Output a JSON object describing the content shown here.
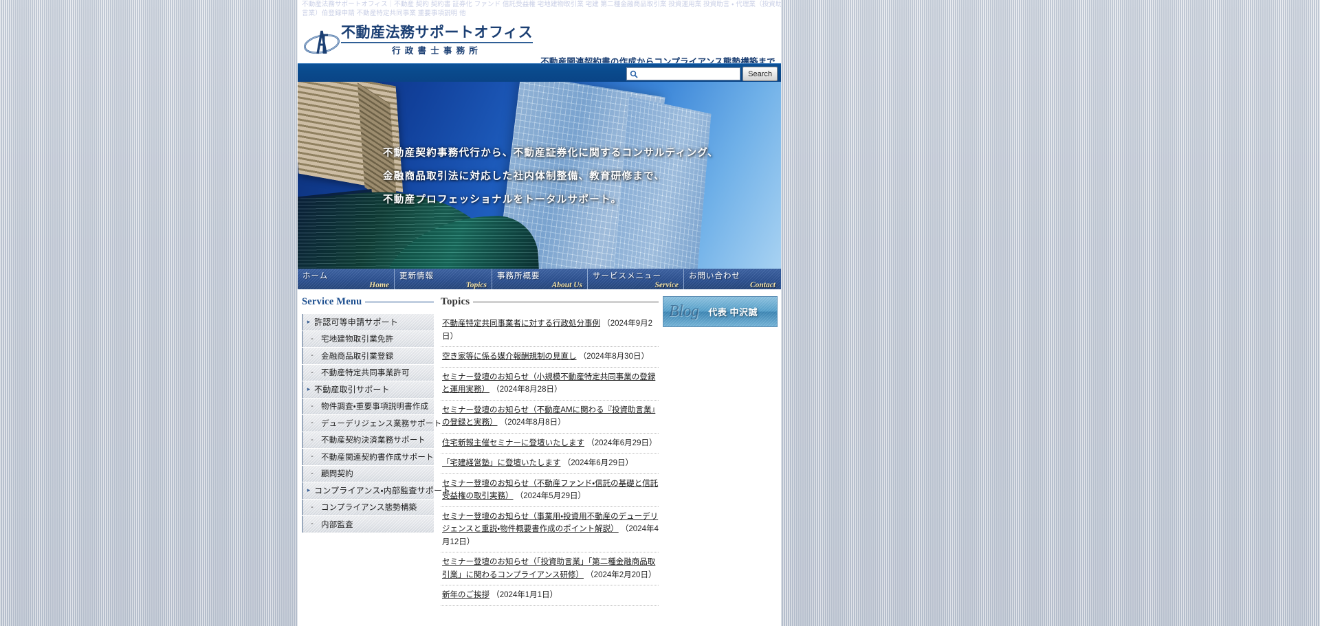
{
  "keyword_strip": "不動産法務サポートオフィス｜不動産 契約 契約書 証券化 ファンド 信託受益権 宅地建物取引業 宅建 第二種金融商品取引業 投資運用業 投資助言 ・ 代理業（投資助言業）伯登録申請 不動産特定共同事業 重要事項説明 他",
  "header": {
    "logo_main": "不動産法務サポートオフィス",
    "logo_sub": "行政書士事務所",
    "logo_icon": "company-monogram-icon",
    "tagline": "不動産関連契約書の作成からコンプライアンス態勢構築まで"
  },
  "search": {
    "icon": "search-icon",
    "value": "",
    "placeholder": "",
    "button_label": "Search"
  },
  "hero": {
    "lines": [
      "不動産契約事務代行から、不動産証券化に関するコンサルティング、",
      "金融商品取引法に対応した社内体制整備、教育研修まで、",
      "不動産プロフェッショナルをトータルサポート。"
    ]
  },
  "nav": [
    {
      "ja": "ホーム",
      "en": "Home"
    },
    {
      "ja": "更新情報",
      "en": "Topics"
    },
    {
      "ja": "事務所概要",
      "en": "About Us"
    },
    {
      "ja": "サービスメニュー",
      "en": "Service"
    },
    {
      "ja": "お問い合わせ",
      "en": "Contact"
    }
  ],
  "sidebar": {
    "heading": "Service Menu",
    "items": [
      {
        "label": "許認可等申請サポート",
        "level": "parent",
        "marker": "▸"
      },
      {
        "label": "宅地建物取引業免許",
        "level": "child",
        "marker": "-"
      },
      {
        "label": "金融商品取引業登録",
        "level": "child",
        "marker": "-"
      },
      {
        "label": "不動産特定共同事業許可",
        "level": "child",
        "marker": "-"
      },
      {
        "label": "不動産取引サポート",
        "level": "parent",
        "marker": "▸"
      },
      {
        "label": "物件調査・重要事項説明書作成",
        "level": "child",
        "marker": "-"
      },
      {
        "label": "デューデリジェンス業務サポート",
        "level": "child",
        "marker": "-"
      },
      {
        "label": "不動産契約決済業務サポート",
        "level": "child",
        "marker": "-"
      },
      {
        "label": "不動産関連契約書作成サポート",
        "level": "child",
        "marker": "-"
      },
      {
        "label": "顧問契約",
        "level": "child",
        "marker": "-"
      },
      {
        "label": "コンプライアンス・内部監査サポート",
        "level": "parent",
        "marker": "▸"
      },
      {
        "label": "コンプライアンス態勢構築",
        "level": "child",
        "marker": "-"
      },
      {
        "label": "内部監査",
        "level": "child",
        "marker": "-"
      }
    ]
  },
  "topics": {
    "heading": "Topics",
    "items": [
      {
        "title": "不動産特定共同事業者に対する行政処分事例",
        "date": "（2024年9月2日）"
      },
      {
        "title": "空き家等に係る媒介報酬規制の見直し",
        "date": "（2024年8月30日）"
      },
      {
        "title": "セミナー登壇のお知らせ（小規模不動産特定共同事業の登録と運用実務）",
        "date": "（2024年8月28日）"
      },
      {
        "title": "セミナー登壇のお知らせ（不動産AMに関わる『投資助言業』の登録と実務）",
        "date": "（2024年8月8日）"
      },
      {
        "title": "住宅新報主催セミナーに登壇いたします",
        "date": "（2024年6月29日）"
      },
      {
        "title": "「宅建経営塾」に登壇いたします",
        "date": "（2024年6月29日）"
      },
      {
        "title": "セミナー登壇のお知らせ（不動産ファンド・信託の基礎と信託受益権の取引実務）",
        "date": "（2024年5月29日）"
      },
      {
        "title": "セミナー登壇のお知らせ（事業用・投資用不動産のデューデリジェンスと重説・物件概要書作成のポイント解説）",
        "date": "（2024年4月12日）"
      },
      {
        "title": "セミナー登壇のお知らせ（「投資助言業」「第二種金融商品取引業」に関わるコンプライアンス研修）",
        "date": "（2024年2月20日）"
      },
      {
        "title": "新年のご挨拶",
        "date": "（2024年1月1日）"
      }
    ]
  },
  "rail": {
    "blog_word": "Blog",
    "blog_name": "代表 中沢誠"
  },
  "colors": {
    "brand_blue": "#1b3f73",
    "bar_blue": "#0a4a8c",
    "nav_blue": "#2e5394",
    "nav_en_gold": "#f3e2a8",
    "heading_blue": "#1b4d8e"
  }
}
